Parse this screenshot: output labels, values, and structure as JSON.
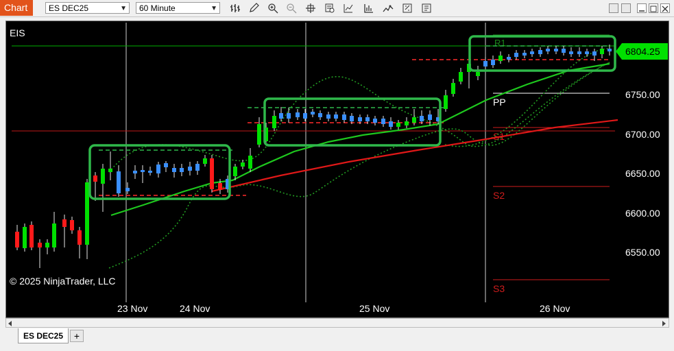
{
  "toolbar": {
    "app_tab": "Chart",
    "instrument": "ES DEC25",
    "interval": "60 Minute",
    "tools": [
      "bar-type-icon",
      "draw-pencil-icon",
      "zoom-in-icon",
      "zoom-out-icon",
      "crosshair-icon",
      "data-box-icon",
      "indicators-icon",
      "strategies-icon",
      "templates-icon",
      "properties-icon",
      "snapshot-icon"
    ]
  },
  "chart": {
    "instrument_label": "EIS",
    "copyright": "© 2025 NinjaTrader, LLC",
    "current_price": "6804.25",
    "price_labels": [
      "6750.00",
      "6700.00",
      "6650.00",
      "6600.00",
      "6550.00"
    ],
    "date_labels": [
      "23 Nov",
      "24 Nov",
      "25 Nov",
      "26 Nov"
    ],
    "pivot_labels": {
      "r1": "R1",
      "pp": "PP",
      "s1": "S1",
      "s2": "S2",
      "s3": "S3"
    },
    "colors": {
      "up": "#00e000",
      "down": "#ff1a1a",
      "neutral": "#3a8fff",
      "box": "#2fb84a",
      "price_tag": "#00e000"
    }
  },
  "tabs": {
    "active": "ES DEC25",
    "add": "+"
  }
}
